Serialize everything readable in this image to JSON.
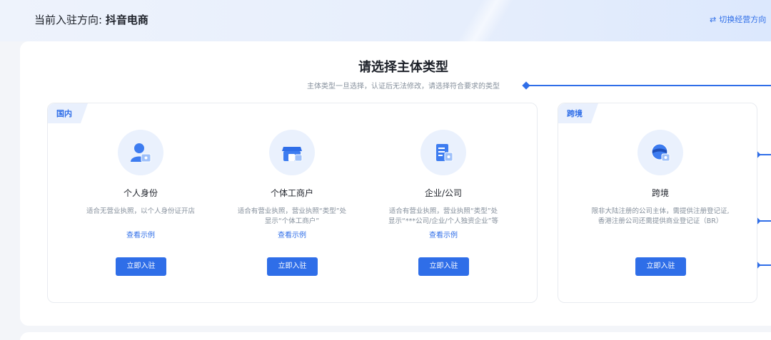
{
  "header": {
    "direction_label": "当前入驻方向: ",
    "direction_value": "抖音电商",
    "switch_label": "切换经营方向"
  },
  "main": {
    "title": "请选择主体类型",
    "subtitle": "主体类型一旦选择，认证后无法修改，请选择符合要求的类型"
  },
  "groups": [
    {
      "tag": "国内",
      "cards": [
        {
          "icon": "person-id-icon",
          "title": "个人身份",
          "desc": [
            "适合无营业执照，以个人身份证开店"
          ],
          "link": "查看示例",
          "button": "立即入驻"
        },
        {
          "icon": "store-icon",
          "title": "个体工商户",
          "desc": [
            "适合有营业执照，营业执照“类型”处",
            "显示“个体工商户”"
          ],
          "link": "查看示例",
          "button": "立即入驻"
        },
        {
          "icon": "company-building-icon",
          "title": "企业/公司",
          "desc": [
            "适合有营业执照，营业执照“类型”处",
            "显示“***公司/企业/个人独资企业”等"
          ],
          "link": "查看示例",
          "button": "立即入驻"
        }
      ]
    },
    {
      "tag": "跨境",
      "cards": [
        {
          "icon": "globe-icon",
          "title": "跨境",
          "desc": [
            "限非大陆注册的公司主体，需提供注册登记证,",
            "香港注册公司还需提供商业登记证（BR）"
          ],
          "button": "立即入驻"
        }
      ]
    }
  ],
  "colors": {
    "accent": "#2f6ee8",
    "accent_light": "#eaf1fd",
    "text": "#1d2129",
    "muted": "#86909c"
  }
}
